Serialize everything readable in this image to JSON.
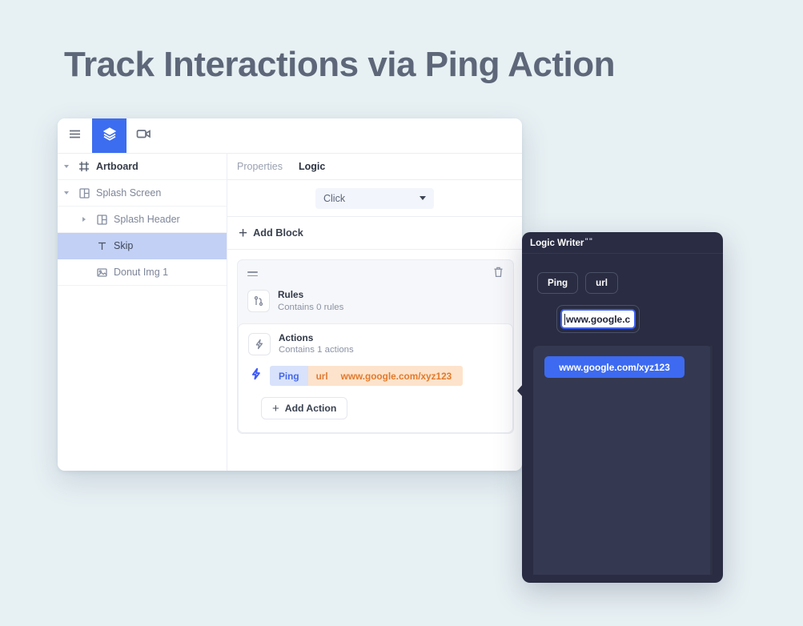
{
  "page": {
    "title": "Track Interactions via Ping Action",
    "background_color": "#e7f0f3",
    "title_color": "#5d6779"
  },
  "app": {
    "toolbar": {
      "items": [
        {
          "icon": "hamburger-menu-icon",
          "label": "Menu",
          "active": false
        },
        {
          "icon": "layers-icon",
          "label": "Layers",
          "active": true
        },
        {
          "icon": "video-camera-icon",
          "label": "Record",
          "active": false
        }
      ],
      "active_color": "#3c6df0"
    },
    "tree": {
      "items": [
        {
          "label": "Artboard",
          "icon": "artboard-frame-icon",
          "indent": 0,
          "caret": "down",
          "selected": false,
          "root": true
        },
        {
          "label": "Splash Screen",
          "icon": "layout-frame-icon",
          "indent": 0,
          "caret": "down",
          "selected": false,
          "root": false
        },
        {
          "label": "Splash Header",
          "icon": "layout-frame-icon",
          "indent": 1,
          "caret": "right",
          "selected": false,
          "root": false
        },
        {
          "label": "Skip",
          "icon": "text-type-icon",
          "indent": 2,
          "caret": "none",
          "selected": true,
          "root": false
        },
        {
          "label": "Donut Img 1",
          "icon": "image-icon",
          "indent": 2,
          "caret": "none",
          "selected": false,
          "root": false
        }
      ],
      "selected_color": "#c2d0f5"
    },
    "panel": {
      "tabs": [
        {
          "label": "Properties",
          "active": false
        },
        {
          "label": "Logic",
          "active": true
        }
      ],
      "trigger_select": {
        "value": "Click",
        "options": [
          "Click"
        ]
      },
      "add_block_label": "Add Block",
      "block": {
        "rules": {
          "title": "Rules",
          "subtitle": "Contains 0 rules",
          "icon": "rules-branch-icon"
        },
        "actions": {
          "title": "Actions",
          "subtitle": "Contains 1 actions",
          "icon": "action-bolt-icon"
        },
        "action_row": {
          "icon": "bolt-icon",
          "name": "Ping",
          "param_key": "url",
          "param_value": "www.google.com/xyz123",
          "name_color": "#4668e8",
          "name_bg": "#d8e2fb",
          "param_color": "#e27a2b",
          "param_bg": "#fde3cb"
        },
        "add_action_label": "Add Action",
        "delete_icon": "trash-icon",
        "drag_icon": "drag-handle-icon"
      }
    }
  },
  "logic_writer": {
    "title": "Logic Writer",
    "title_suffix": "\"\"",
    "chips": [
      {
        "label": "Ping"
      },
      {
        "label": "url"
      }
    ],
    "input": {
      "value": "www.google.c",
      "focused": true
    },
    "suggestions": [
      {
        "label": "www.google.com/xyz123"
      }
    ],
    "panel_color": "#292c42",
    "suggest_panel_color": "#343850",
    "accent_color": "#3d6af0"
  }
}
